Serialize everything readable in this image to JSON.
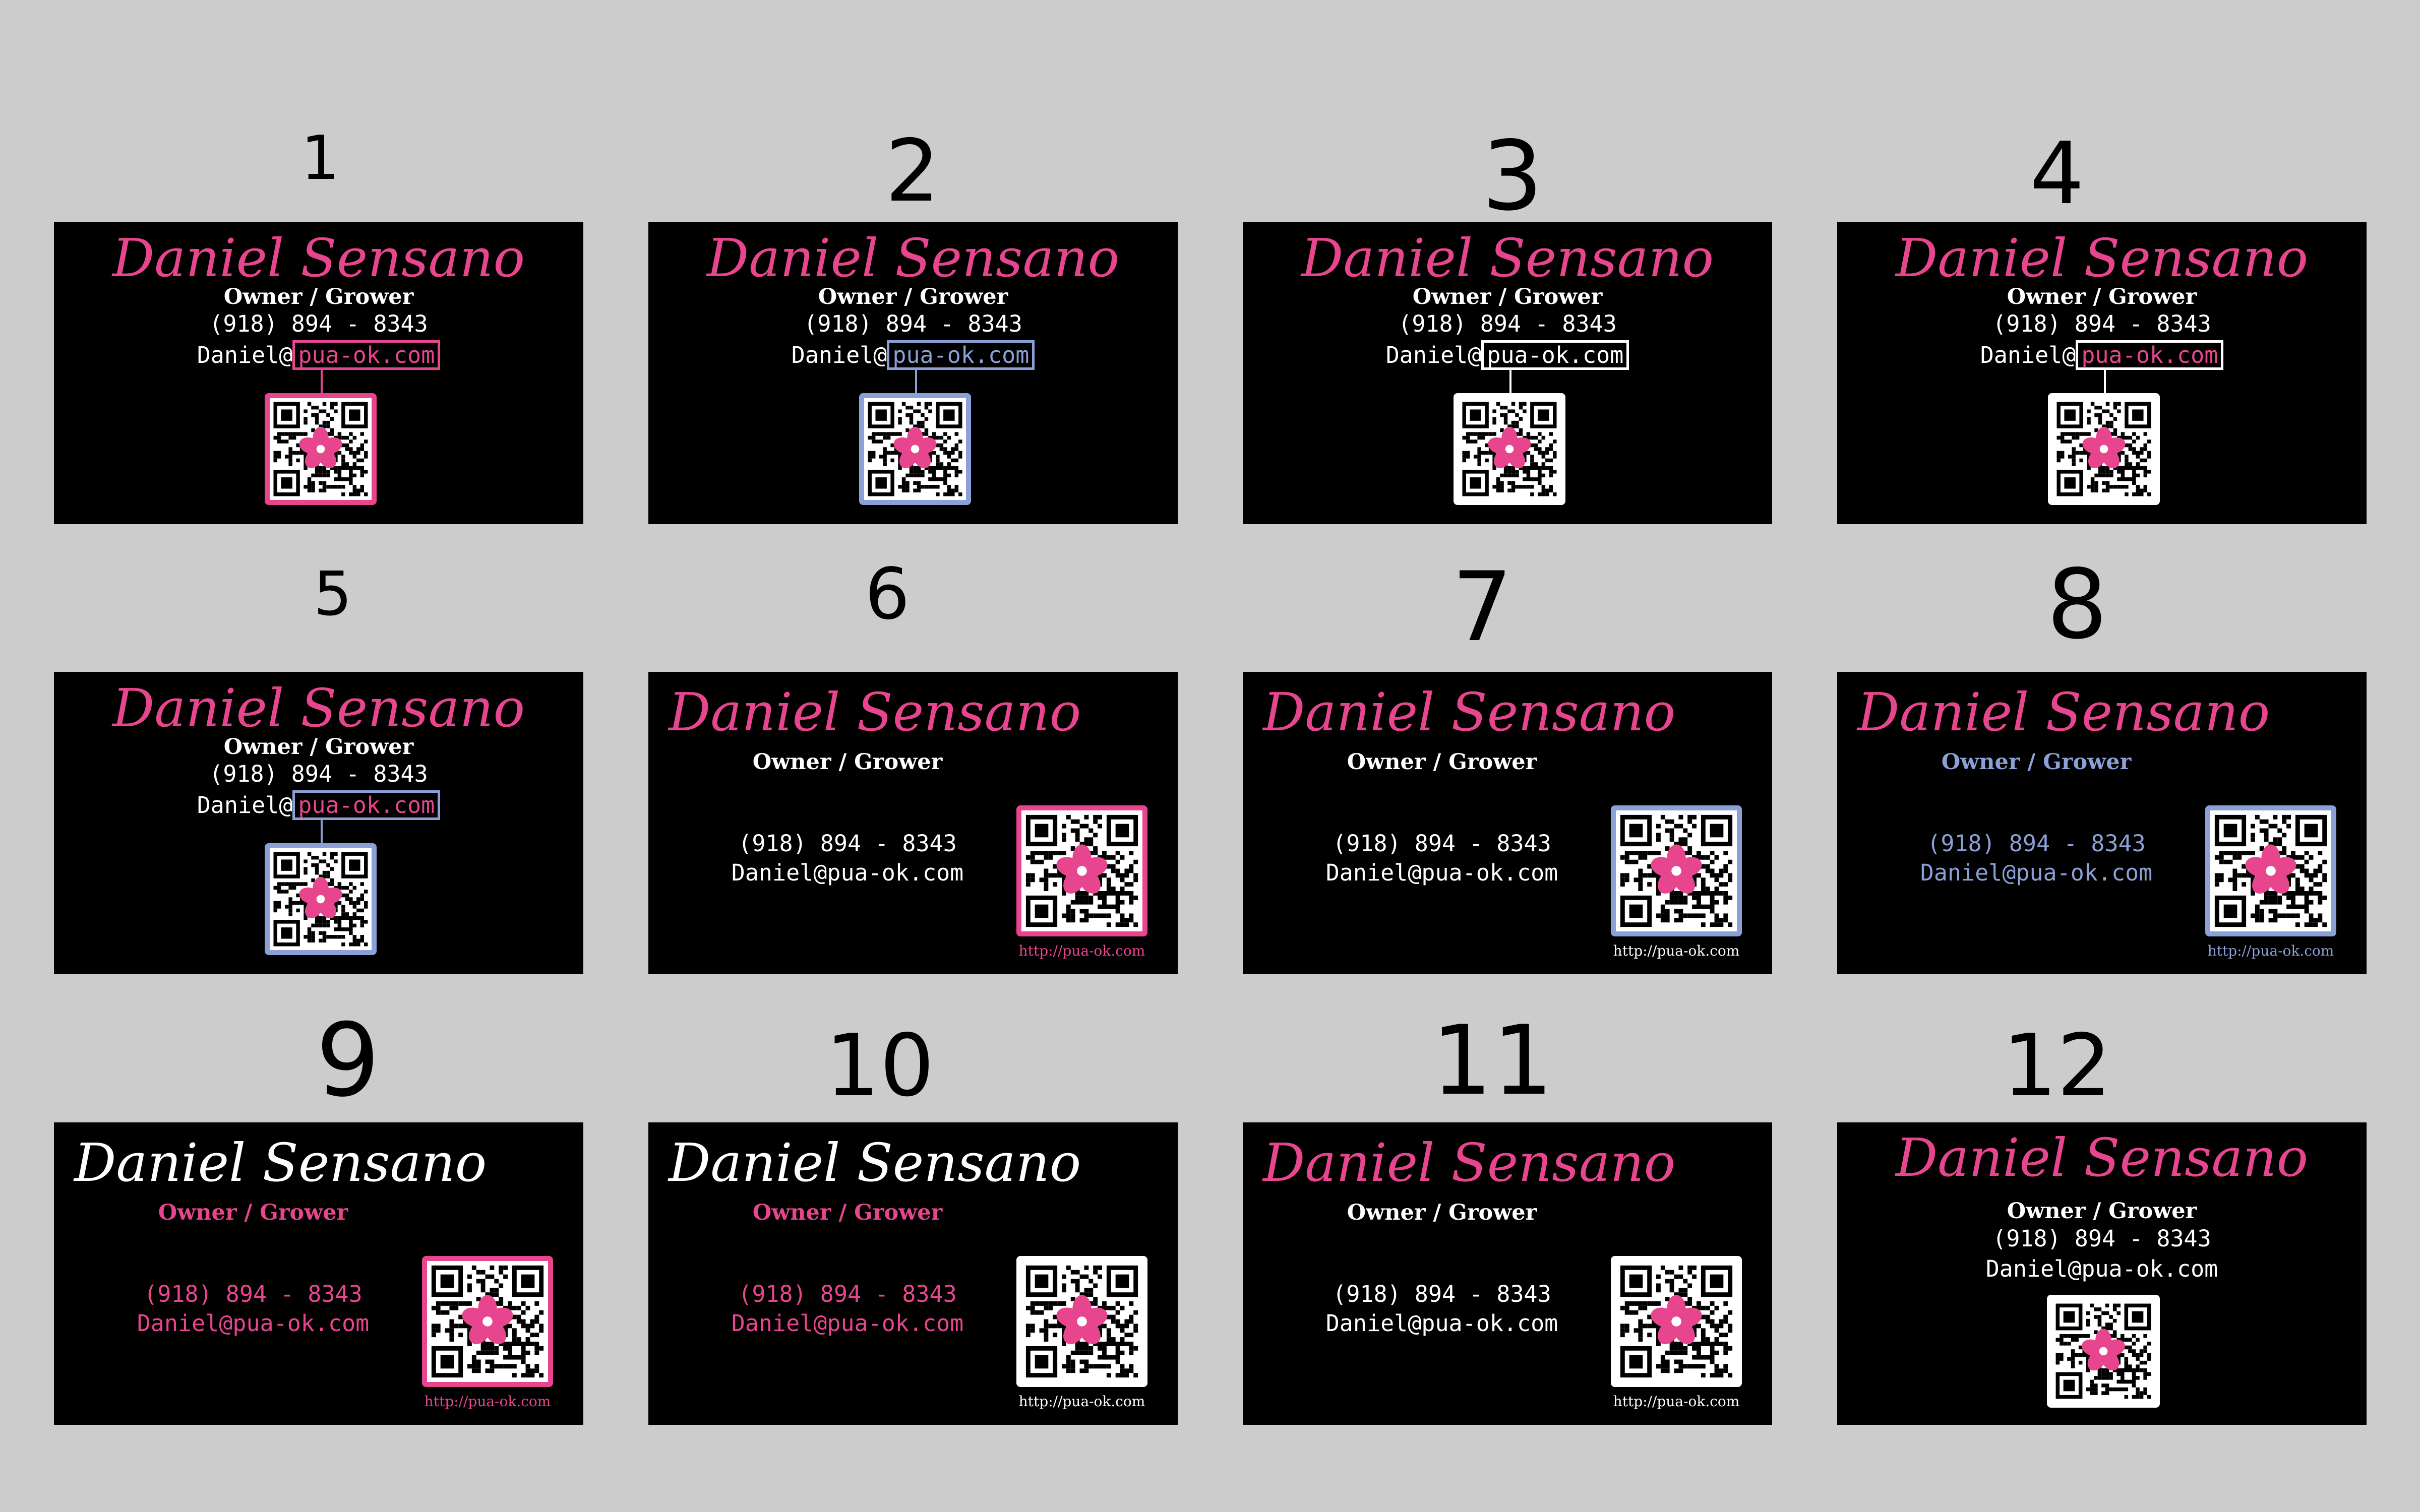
{
  "card_text": {
    "name": "Daniel Sensano",
    "title": "Owner / Grower",
    "phone": "(918) 894 - 8343",
    "email": "Daniel@pua-ok.com",
    "email_user": "Daniel@",
    "email_domain": "pua-ok.com",
    "url": "http://pua-ok.com"
  },
  "colors": {
    "pink": "#e8458f",
    "blue": "#8aa0d6",
    "white": "#ffffff",
    "card_background": "#000000",
    "page_background": "#cccccc"
  },
  "icons": [
    "qr-code-icon",
    "hibiscus-flower-icon"
  ],
  "cards": [
    {
      "number": "1",
      "layout": "centered-qr",
      "name_color": "pink",
      "domain_box_color": "pink",
      "qr_border": "pink"
    },
    {
      "number": "2",
      "layout": "centered-qr",
      "name_color": "pink",
      "domain_box_color": "blue",
      "qr_border": "blue"
    },
    {
      "number": "3",
      "layout": "centered-qr",
      "name_color": "pink",
      "domain_box_color": "white",
      "qr_border": "white"
    },
    {
      "number": "4",
      "layout": "centered-qr",
      "name_color": "pink",
      "domain_box_color": "white",
      "domain_text_color": "pink",
      "qr_border": "white"
    },
    {
      "number": "5",
      "layout": "centered-qr",
      "name_color": "pink",
      "domain_box_color": "blue",
      "domain_text_color": "pink",
      "qr_border": "blue"
    },
    {
      "number": "6",
      "layout": "side-qr",
      "name_color": "pink",
      "title_color": "white",
      "contact_color": "white",
      "qr_border": "pink",
      "url_color": "pink"
    },
    {
      "number": "7",
      "layout": "side-qr",
      "name_color": "pink",
      "title_color": "white",
      "contact_color": "white",
      "qr_border": "blue",
      "url_color": "white"
    },
    {
      "number": "8",
      "layout": "side-qr",
      "name_color": "pink",
      "title_color": "blue",
      "contact_color": "blue",
      "qr_border": "blue",
      "url_color": "blue"
    },
    {
      "number": "9",
      "layout": "side-qr",
      "name_color": "white",
      "title_color": "pink",
      "contact_color": "pink",
      "qr_border": "pink",
      "url_color": "pink"
    },
    {
      "number": "10",
      "layout": "side-qr",
      "name_color": "white",
      "title_color": "pink",
      "contact_color": "pink",
      "qr_border": "white",
      "url_color": "white"
    },
    {
      "number": "11",
      "layout": "side-qr",
      "name_color": "pink",
      "title_color": "white",
      "contact_color": "white",
      "qr_border": "white",
      "url_color": "white"
    },
    {
      "number": "12",
      "layout": "centered-plain",
      "name_color": "pink",
      "title_color": "white",
      "contact_color": "white",
      "qr_border": "white"
    }
  ]
}
